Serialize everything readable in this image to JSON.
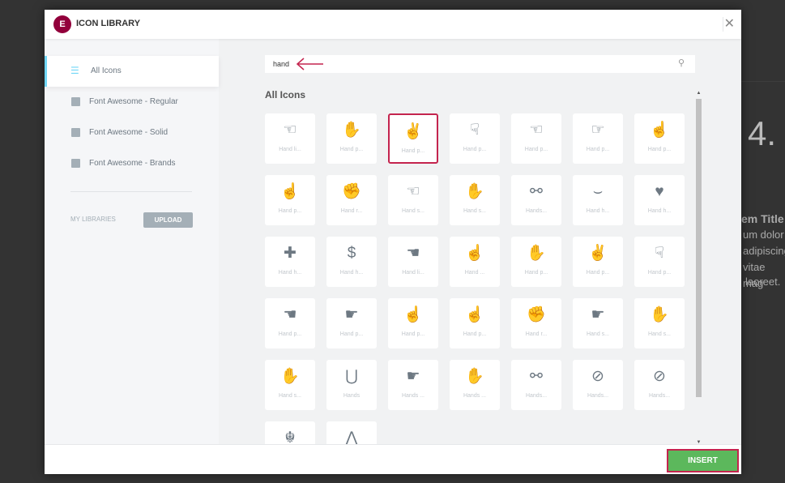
{
  "background": {
    "number": "4.",
    "lines": [
      "em Title",
      "um dolor",
      "adipiscing",
      "vitae mag",
      "laoreet."
    ]
  },
  "header": {
    "logo": "E",
    "title": "ICON LIBRARY",
    "close": "✕"
  },
  "sidebar": {
    "items": [
      {
        "label": "All Icons",
        "active": true
      },
      {
        "label": "Font Awesome - Regular"
      },
      {
        "label": "Font Awesome - Solid"
      },
      {
        "label": "Font Awesome - Brands"
      }
    ],
    "my_libraries": "MY LIBRARIES",
    "upload": "UPLOAD"
  },
  "search": {
    "value": "hand",
    "icon": "search-icon"
  },
  "grid_title": "All Icons",
  "icons": [
    {
      "g": "☜",
      "l": "Hand li..."
    },
    {
      "g": "✋",
      "l": "Hand p..."
    },
    {
      "g": "✌",
      "l": "Hand p...",
      "selected": true
    },
    {
      "g": "☟",
      "l": "Hand p..."
    },
    {
      "g": "☜",
      "l": "Hand p..."
    },
    {
      "g": "☞",
      "l": "Hand p..."
    },
    {
      "g": "☝",
      "l": "Hand p..."
    },
    {
      "g": "☝",
      "l": "Hand p..."
    },
    {
      "g": "✊",
      "l": "Hand r..."
    },
    {
      "g": "☜",
      "l": "Hand s..."
    },
    {
      "g": "✋",
      "l": "Hand s..."
    },
    {
      "g": "⚯",
      "l": "Hands..."
    },
    {
      "g": "⌣",
      "l": "Hand h..."
    },
    {
      "g": "♥",
      "l": "Hand h..."
    },
    {
      "g": "✚",
      "l": "Hand h..."
    },
    {
      "g": "$",
      "l": "Hand h..."
    },
    {
      "g": "☚",
      "l": "Hand li..."
    },
    {
      "g": "☝",
      "l": "Hand ..."
    },
    {
      "g": "✋",
      "l": "Hand p..."
    },
    {
      "g": "✌",
      "l": "Hand p..."
    },
    {
      "g": "☟",
      "l": "Hand p..."
    },
    {
      "g": "☚",
      "l": "Hand p..."
    },
    {
      "g": "☛",
      "l": "Hand p..."
    },
    {
      "g": "☝",
      "l": "Hand p..."
    },
    {
      "g": "☝",
      "l": "Hand p..."
    },
    {
      "g": "✊",
      "l": "Hand r..."
    },
    {
      "g": "☛",
      "l": "Hand s..."
    },
    {
      "g": "✋",
      "l": "Hand s..."
    },
    {
      "g": "✋",
      "l": "Hand s..."
    },
    {
      "g": "⋃",
      "l": "Hands"
    },
    {
      "g": "☛",
      "l": "Hands ..."
    },
    {
      "g": "✋",
      "l": "Hands ..."
    },
    {
      "g": "⚯",
      "l": "Hands..."
    },
    {
      "g": "⊘",
      "l": "Hands..."
    },
    {
      "g": "⊘",
      "l": "Hands..."
    },
    {
      "g": "☬",
      "l": ""
    },
    {
      "g": "⋀",
      "l": ""
    }
  ],
  "footer": {
    "insert": "INSERT"
  },
  "colors": {
    "accent": "#92003b",
    "highlight": "#c4244e",
    "insert": "#5cb85c",
    "active_bar": "#71d7f7"
  }
}
